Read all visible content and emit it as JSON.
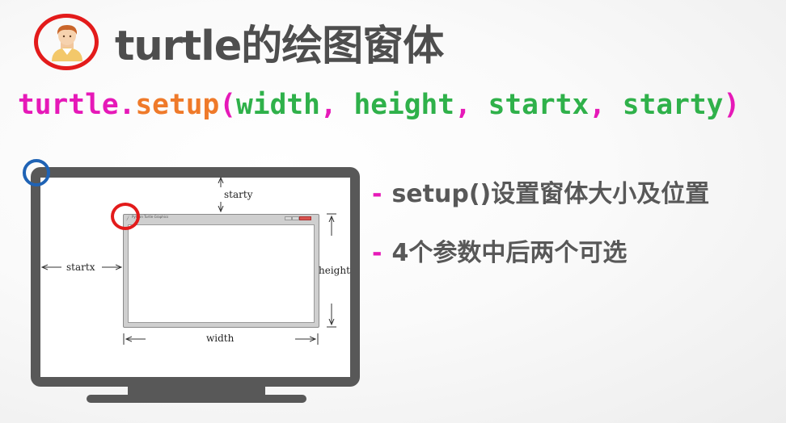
{
  "heading": {
    "title": "turtle的绘图窗体"
  },
  "code": {
    "func_name": "turtle",
    "dot": ".",
    "method": "setup",
    "open_paren": "(",
    "arg1": "width",
    "comma1": ", ",
    "arg2": "height",
    "comma2": ", ",
    "arg3": "startx",
    "comma3": ", ",
    "arg4": "starty",
    "close_paren": ")"
  },
  "diagram": {
    "window_title": "Python Turtle Graphics",
    "label_starty": "starty",
    "label_startx": "startx",
    "label_height": "height",
    "label_width": "width"
  },
  "bullets": [
    {
      "dash": "-",
      "text": "setup()设置窗体大小及位置"
    },
    {
      "dash": "-",
      "text": "4个参数中后两个可选"
    }
  ],
  "colors": {
    "title": "#4e4e4e",
    "code_magenta": "#e619b8",
    "code_orange": "#ef7a2a",
    "code_green": "#2fb14a",
    "monitor": "#585858",
    "highlight_red": "#e31b1b",
    "highlight_blue": "#1f63b5"
  },
  "icons": [
    "avatar-icon",
    "feather-icon"
  ]
}
